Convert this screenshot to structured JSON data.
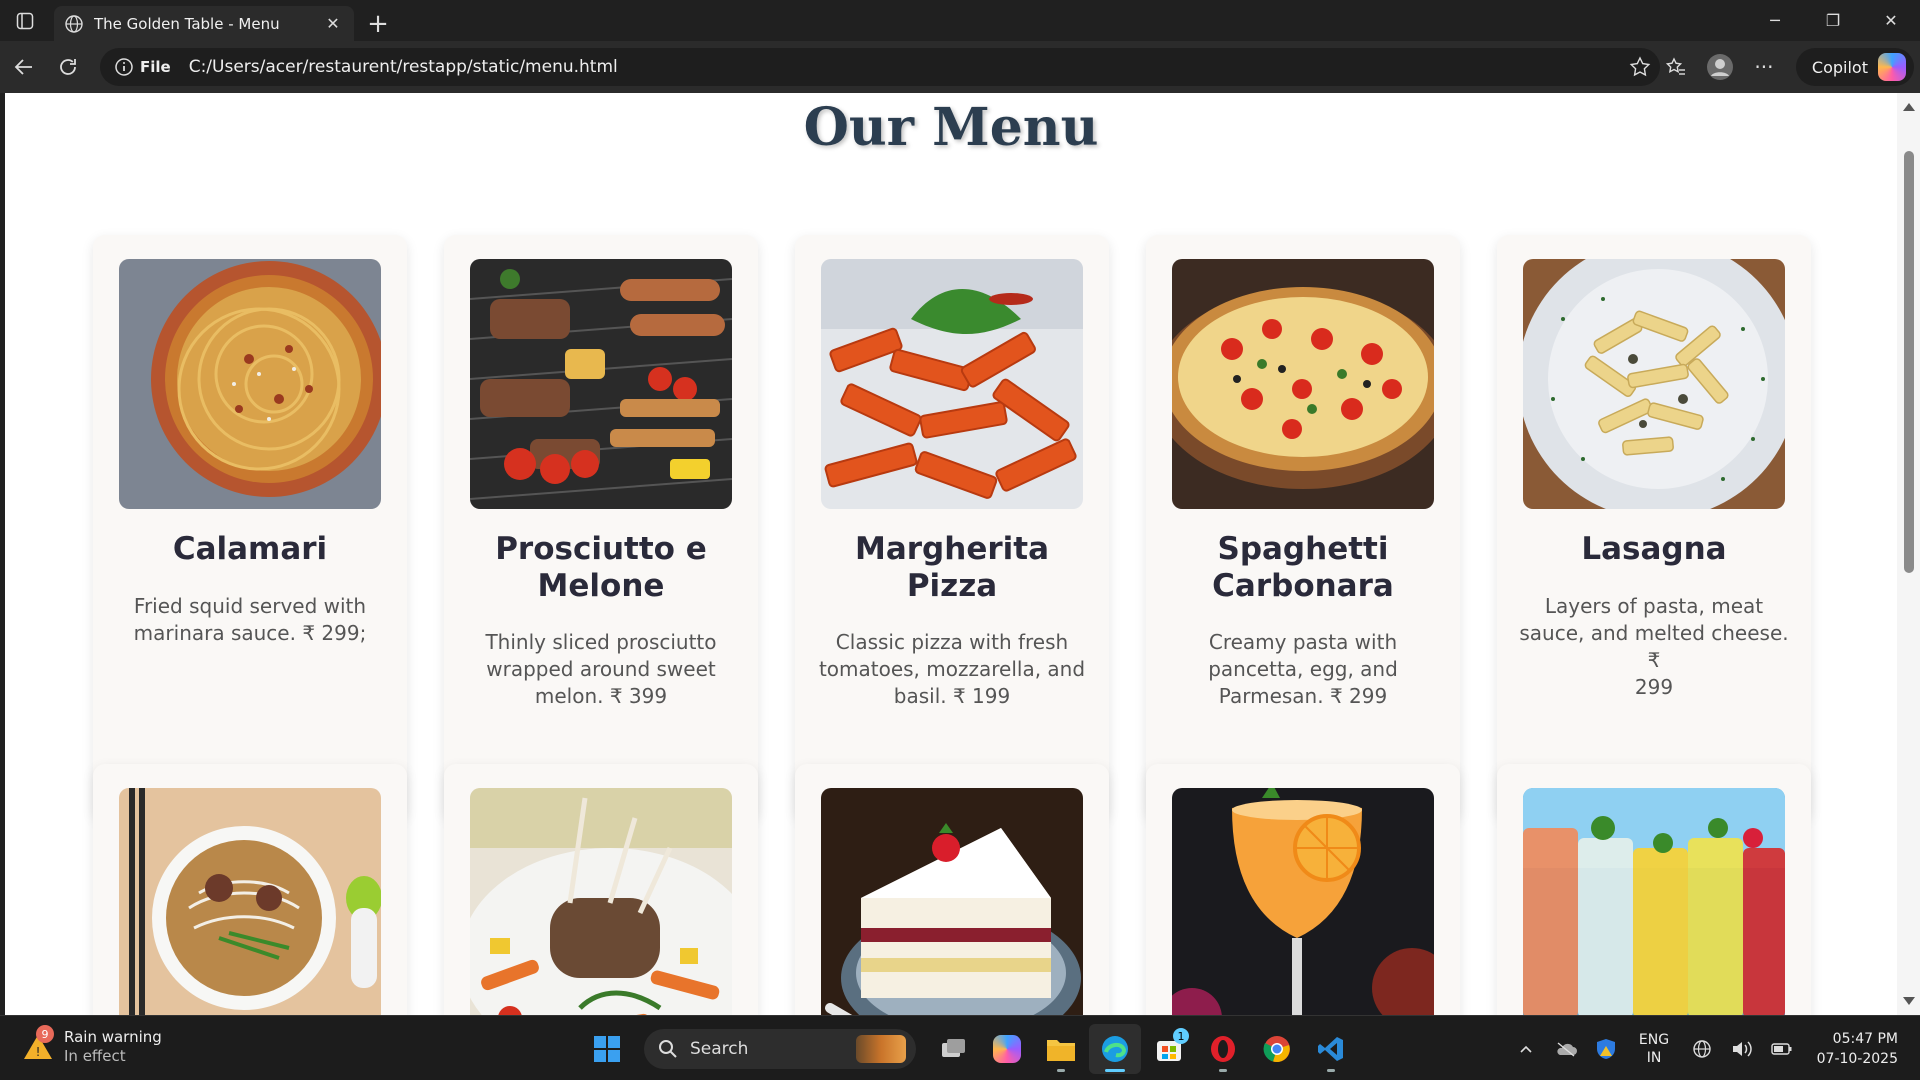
{
  "browser": {
    "tab_title": "The Golden Table - Menu",
    "address_scheme": "File",
    "url": "C:/Users/acer/restaurent/restapp/static/menu.html",
    "copilot_label": "Copilot"
  },
  "page": {
    "title": "Our Menu",
    "menu_items": [
      {
        "name_lines": [
          "Calamari"
        ],
        "desc_lines": [
          "Fried squid served with",
          "marinara sauce. ₹ 299;"
        ],
        "image": "spaghetti-bowl"
      },
      {
        "name_lines": [
          "Prosciutto e",
          "Melone"
        ],
        "desc_lines": [
          "Thinly sliced prosciutto",
          "wrapped around sweet",
          "melon. ₹ 399"
        ],
        "image": "grill-platter"
      },
      {
        "name_lines": [
          "Margherita",
          "Pizza"
        ],
        "desc_lines": [
          "Classic pizza with fresh",
          "tomatoes, mozzarella, and",
          "basil. ₹ 199"
        ],
        "image": "penne-arrabbiata"
      },
      {
        "name_lines": [
          "Spaghetti",
          "Carbonara"
        ],
        "desc_lines": [
          "Creamy pasta with",
          "pancetta, egg, and",
          "Parmesan. ₹ 299"
        ],
        "image": "pizza"
      },
      {
        "name_lines": [
          "Lasagna"
        ],
        "desc_lines": [
          "Layers of pasta, meat",
          "sauce, and melted cheese. ₹",
          "299"
        ],
        "image": "creamy-penne"
      }
    ],
    "second_row_images": [
      "pho-bowl",
      "lamb-chops",
      "layer-cake",
      "orange-cocktail",
      "fruit-drinks"
    ]
  },
  "taskbar": {
    "weather_title": "Rain warning",
    "weather_sub": "In effect",
    "weather_badge": "9",
    "search_label": "Search",
    "store_badge": "1",
    "lang_top": "ENG",
    "lang_bottom": "IN",
    "time": "05:47 PM",
    "date": "07-10-2025"
  }
}
